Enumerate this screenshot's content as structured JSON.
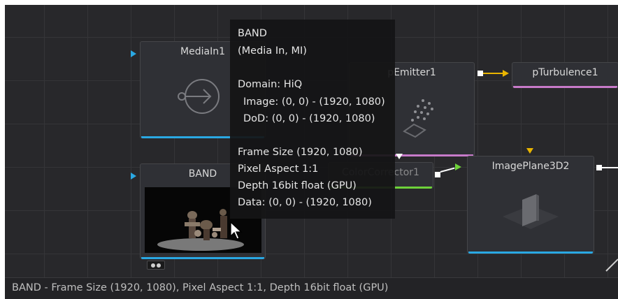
{
  "nodes": {
    "mediain": {
      "title": "MediaIn1"
    },
    "pemitter": {
      "title": "pEmitter1"
    },
    "pturbulence": {
      "title": "pTurbulence1"
    },
    "band": {
      "title": "BAND"
    },
    "colorcorrector": {
      "title": "ColorCorrector1"
    },
    "imageplane": {
      "title": "ImagePlane3D2"
    }
  },
  "tooltip": {
    "line1": "BAND",
    "line2": "(Media In, MI)",
    "line3": "Domain: HiQ",
    "line4": "Image: (0, 0) - (1920, 1080)",
    "line5": "DoD: (0, 0) - (1920, 1080)",
    "line6": "Frame Size (1920, 1080)",
    "line7": "Pixel Aspect 1:1",
    "line8": "Depth 16bit float (GPU)",
    "line9": "Data: (0, 0) - (1920, 1080)"
  },
  "status": {
    "text": "BAND - Frame Size (1920, 1080), Pixel Aspect 1:1, Depth 16bit float (GPU)"
  },
  "colors": {
    "canvas_bg": "#28282b",
    "input_blue": "#2aa8e3",
    "mask_yellow": "#e8b400",
    "particle_pink": "#c77ac9",
    "colorcorrect_green": "#6ed23a"
  },
  "icons": {
    "mediain": "media-in-icon",
    "pemitter": "particle-emitter-icon",
    "imageplane": "image-plane-icon",
    "band_thumb": "video-thumbnail",
    "cursor": "mouse-pointer-icon"
  }
}
